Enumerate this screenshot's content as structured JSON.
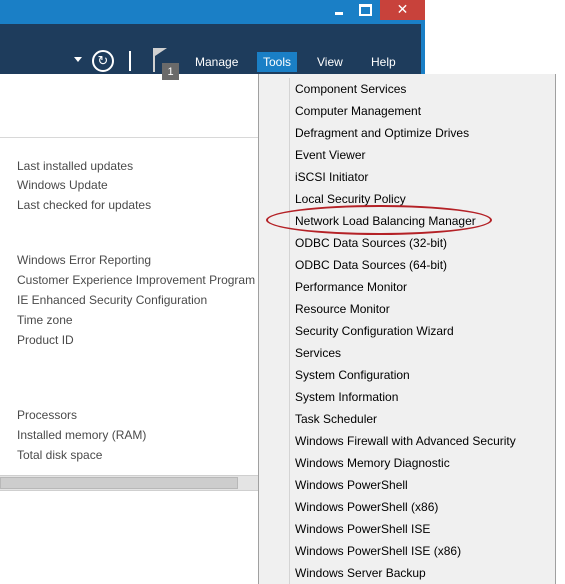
{
  "toolbar": {
    "notification_count": "1",
    "menus": [
      "Manage",
      "Tools",
      "View",
      "Help"
    ]
  },
  "left_panel": {
    "labels": [
      "Last installed updates",
      "Windows Update",
      "Last checked for updates",
      "Windows Error Reporting",
      "Customer Experience Improvement Program",
      "IE Enhanced Security Configuration",
      "Time zone",
      "Product ID",
      "Processors",
      "Installed memory (RAM)",
      "Total disk space"
    ]
  },
  "tools_menu": {
    "items": [
      "Component Services",
      "Computer Management",
      "Defragment and Optimize Drives",
      "Event Viewer",
      "iSCSI Initiator",
      "Local Security Policy",
      "Network Load Balancing Manager",
      "ODBC Data Sources (32-bit)",
      "ODBC Data Sources (64-bit)",
      "Performance Monitor",
      "Resource Monitor",
      "Security Configuration Wizard",
      "Services",
      "System Configuration",
      "System Information",
      "Task Scheduler",
      "Windows Firewall with Advanced Security",
      "Windows Memory Diagnostic",
      "Windows PowerShell",
      "Windows PowerShell (x86)",
      "Windows PowerShell ISE",
      "Windows PowerShell ISE (x86)",
      "Windows Server Backup"
    ],
    "highlighted_item": "Network Load Balancing Manager"
  },
  "colors": {
    "title_bar": "#1a7fc6",
    "command_bar": "#1e3c5c",
    "close_button": "#c8423b",
    "highlight_ring": "#b42126"
  },
  "icons": [
    "minimize-icon",
    "maximize-icon",
    "close-icon",
    "dropdown-arrow-icon",
    "refresh-icon",
    "notification-flag-icon"
  ]
}
